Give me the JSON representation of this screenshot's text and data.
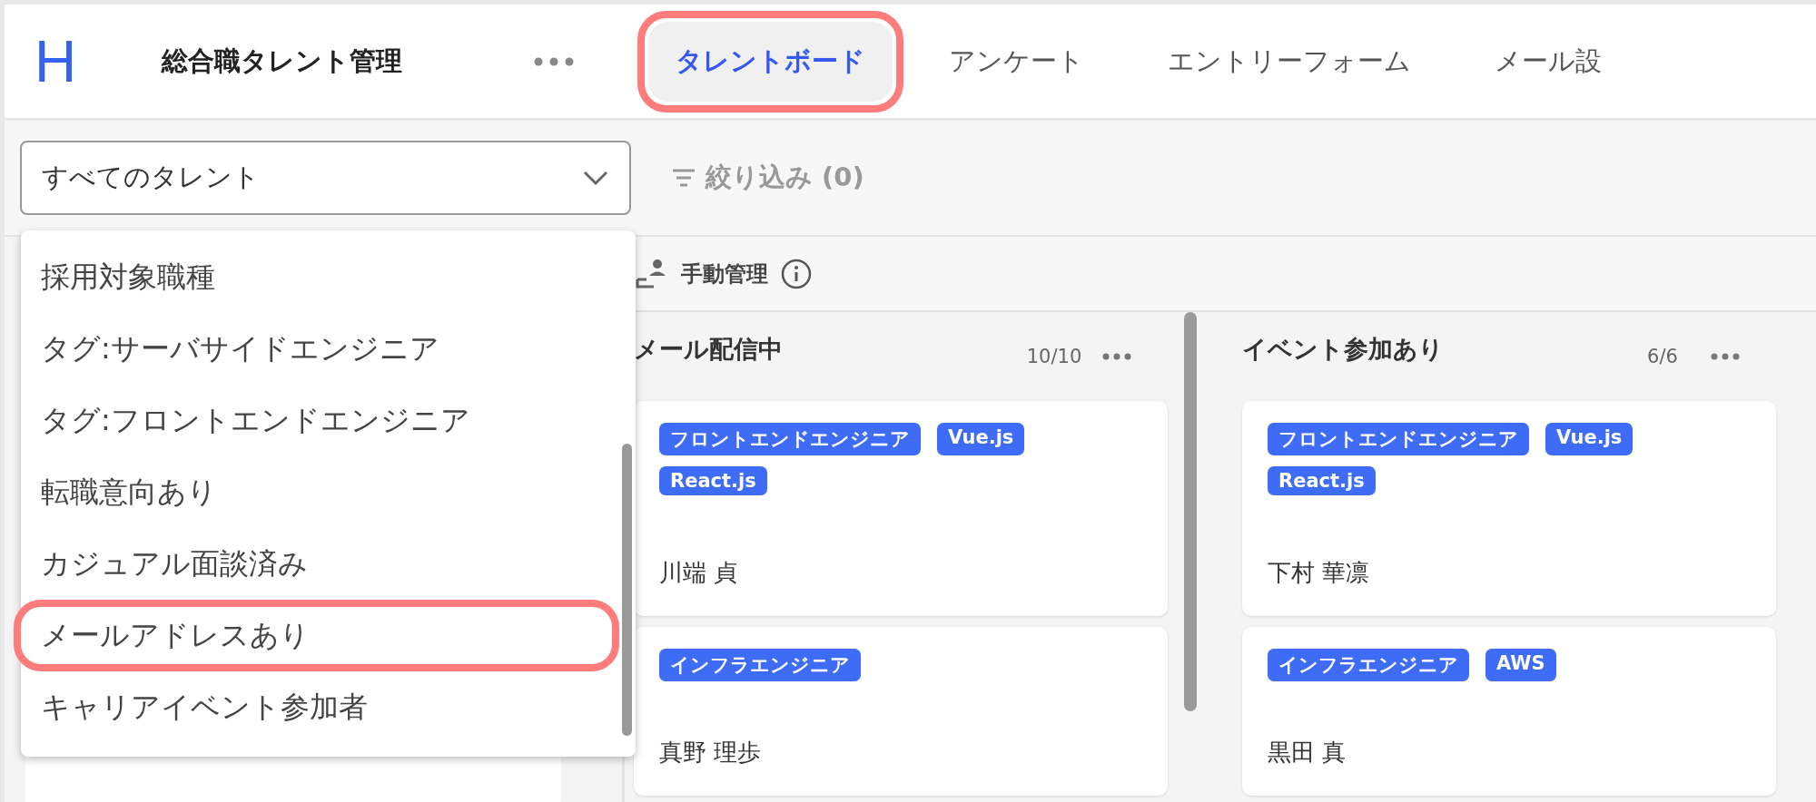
{
  "header": {
    "logo": "H",
    "title": "総合職タレント管理"
  },
  "tabs": [
    {
      "label": "タレントボード",
      "selected": true,
      "highlighted": true
    },
    {
      "label": "アンケート",
      "selected": false,
      "highlighted": false
    },
    {
      "label": "エントリーフォーム",
      "selected": false,
      "highlighted": false
    },
    {
      "label": "メール設",
      "selected": false,
      "highlighted": false
    }
  ],
  "toolbar": {
    "select": {
      "value": "すべてのタレント",
      "expanded": true
    },
    "filter_button": "絞り込み (0)"
  },
  "dropdown": {
    "options": [
      {
        "label": "採用対象職種",
        "highlighted": false
      },
      {
        "label": "タグ:サーバサイドエンジニア",
        "highlighted": false
      },
      {
        "label": "タグ:フロントエンドエンジニア",
        "highlighted": false
      },
      {
        "label": "転職意向あり",
        "highlighted": false
      },
      {
        "label": "カジュアル面談済み",
        "highlighted": false
      },
      {
        "label": "メールアドレスあり",
        "highlighted": true
      },
      {
        "label": "キャリアイベント参加者",
        "highlighted": false
      }
    ]
  },
  "section": {
    "label": "手動管理"
  },
  "columns": [
    {
      "title": "メール配信中",
      "count": "10/10",
      "cards": [
        {
          "tags": [
            "フロントエンドエンジニア",
            "Vue.js",
            "React.js"
          ],
          "name": "川端 貞"
        },
        {
          "tags": [
            "インフラエンジニア"
          ],
          "name": "真野 理歩"
        }
      ]
    },
    {
      "title": "イベント参加あり",
      "count": "6/6",
      "cards": [
        {
          "tags": [
            "フロントエンドエンジニア",
            "Vue.js",
            "React.js"
          ],
          "name": "下村 華凛"
        },
        {
          "tags": [
            "インフラエンジニア",
            "AWS"
          ],
          "name": "黒田 真"
        }
      ]
    }
  ]
}
